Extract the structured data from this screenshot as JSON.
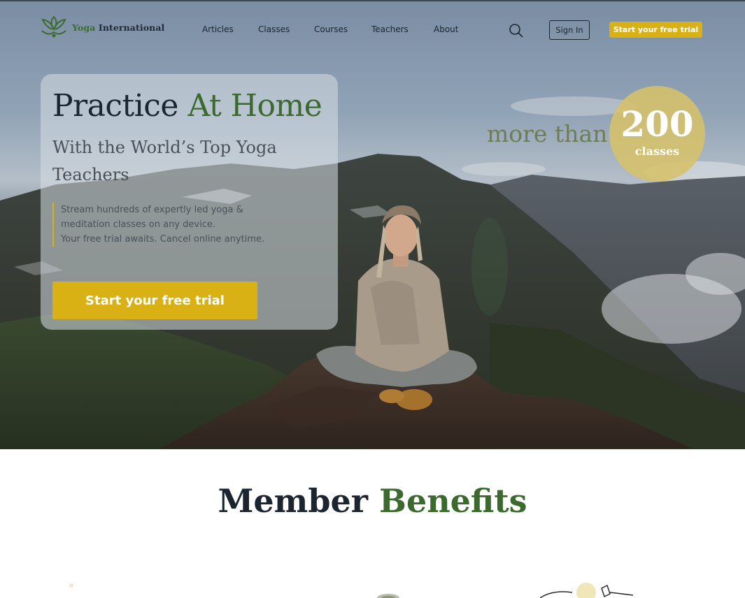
{
  "brand": {
    "name_first": "Yoga",
    "name_second": "International",
    "logo_icon": "lotus-icon"
  },
  "nav": {
    "links": [
      "Articles",
      "Classes",
      "Courses",
      "Teachers",
      "About"
    ],
    "search_icon": "search-icon",
    "signin_label": "Sign In",
    "trial_label": "Start your free trial"
  },
  "hero": {
    "title_dark": "Practice",
    "title_green": "At Home",
    "subtitle": "With the World’s Top Yoga Teachers",
    "description_line1": "Stream hundreds of expertly led yoga &",
    "description_line2": "meditation classes on any device.",
    "description_line3": "Your free trial awaits. Cancel online anytime.",
    "cta_label": "Start your free trial"
  },
  "stats": {
    "prefix": "more than",
    "count": "200",
    "unit": "classes"
  },
  "benefits": {
    "title_dark": "Member",
    "title_green": "Benefits"
  },
  "colors": {
    "accent_yellow": "#d9b114",
    "brand_green": "#3c6a2e",
    "text_dark": "#1b2530",
    "badge_gold": "#d6c26a"
  }
}
